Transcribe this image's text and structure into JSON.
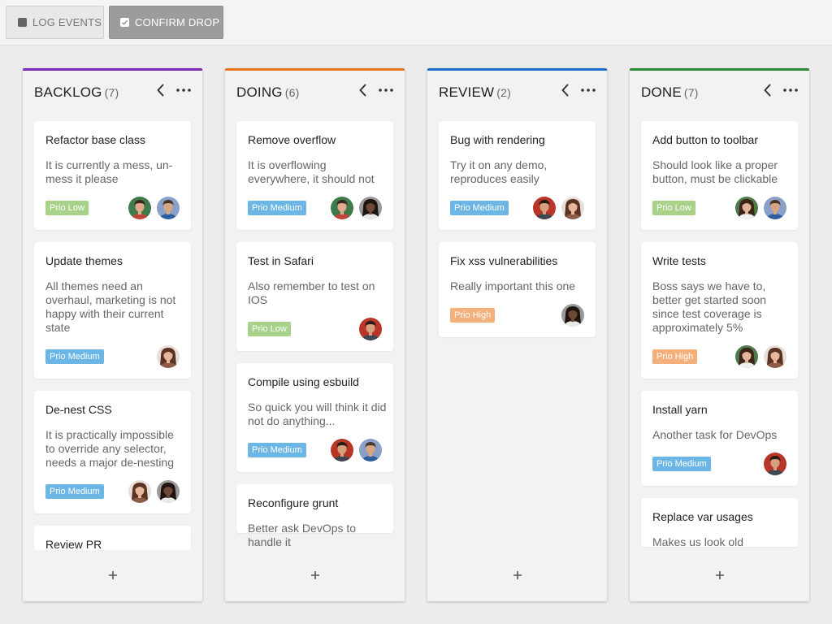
{
  "toolbar": {
    "log_events_label": "LOG EVENTS",
    "confirm_drop_label": "CONFIRM DROP"
  },
  "colors": {
    "backlog": "#7b2ab0",
    "doing": "#e8771e",
    "review": "#1e6fc9",
    "done": "#2e8b34",
    "prio_low": "#a8d18a",
    "prio_medium": "#6cb6e6",
    "prio_high": "#f4b07c"
  },
  "columns": [
    {
      "title": "BACKLOG",
      "count": "(7)",
      "collapse_icon": "chevron-left-icon",
      "menu_icon": "more-horizontal-icon",
      "add_icon": "plus-icon",
      "cards": [
        {
          "title": "Refactor base class",
          "description": "It is currently a mess, un-mess it please",
          "tag": "Prio Low",
          "avatars": [
            {
              "name": "avatar-man-green"
            },
            {
              "name": "avatar-man-blue"
            }
          ]
        },
        {
          "title": "Update themes",
          "description": "All themes need an overhaul, marketing is not happy with their current state",
          "tag": "Prio Medium",
          "avatars": [
            {
              "name": "avatar-woman-brown"
            }
          ]
        },
        {
          "title": "De-nest CSS",
          "description": "It is practically impossible to override any selector, needs a major de-nesting",
          "tag": "Prio Medium",
          "avatars": [
            {
              "name": "avatar-woman-brown"
            },
            {
              "name": "avatar-woman-curly"
            }
          ]
        },
        {
          "title": "Review PR",
          "description": "",
          "tag": "",
          "avatars": []
        }
      ]
    },
    {
      "title": "DOING",
      "count": "(6)",
      "collapse_icon": "chevron-left-icon",
      "menu_icon": "more-horizontal-icon",
      "add_icon": "plus-icon",
      "cards": [
        {
          "title": "Remove overflow",
          "description": "It is overflowing everywhere, it should not",
          "tag": "Prio Medium",
          "avatars": [
            {
              "name": "avatar-man-green"
            },
            {
              "name": "avatar-woman-curly"
            }
          ]
        },
        {
          "title": "Test in Safari",
          "description": "Also remember to test on IOS",
          "tag": "Prio Low",
          "avatars": [
            {
              "name": "avatar-man-red"
            }
          ]
        },
        {
          "title": "Compile using esbuild",
          "description": "So quick you will think it did not do anything...",
          "tag": "Prio Medium",
          "avatars": [
            {
              "name": "avatar-man-red"
            },
            {
              "name": "avatar-man-blue"
            }
          ]
        },
        {
          "title": "Reconfigure grunt",
          "description": "Better ask DevOps to handle it",
          "tag": "",
          "avatars": []
        }
      ]
    },
    {
      "title": "REVIEW",
      "count": "(2)",
      "collapse_icon": "chevron-left-icon",
      "menu_icon": "more-horizontal-icon",
      "add_icon": "plus-icon",
      "cards": [
        {
          "title": "Bug with rendering",
          "description": "Try it on any demo, reproduces easily",
          "tag": "Prio Medium",
          "avatars": [
            {
              "name": "avatar-man-red"
            },
            {
              "name": "avatar-woman-brown"
            }
          ]
        },
        {
          "title": "Fix xss vulnerabilities",
          "description": "Really important this one",
          "tag": "Prio High",
          "avatars": [
            {
              "name": "avatar-woman-curly"
            }
          ]
        }
      ]
    },
    {
      "title": "DONE",
      "count": "(7)",
      "collapse_icon": "chevron-left-icon",
      "menu_icon": "more-horizontal-icon",
      "add_icon": "plus-icon",
      "cards": [
        {
          "title": "Add button to toolbar",
          "description": "Should look like a proper button, must be clickable",
          "tag": "Prio Low",
          "avatars": [
            {
              "name": "avatar-woman-green"
            },
            {
              "name": "avatar-man-blue"
            }
          ]
        },
        {
          "title": "Write tests",
          "description": "Boss says we have to, better get started soon since test coverage is approximately 5%",
          "tag": "Prio High",
          "avatars": [
            {
              "name": "avatar-woman-green"
            },
            {
              "name": "avatar-woman-brown"
            }
          ]
        },
        {
          "title": "Install yarn",
          "description": "Another task for DevOps",
          "tag": "Prio Medium",
          "avatars": [
            {
              "name": "avatar-man-red"
            }
          ]
        },
        {
          "title": "Replace var usages",
          "description": "Makes us look old",
          "tag": "",
          "avatars": []
        }
      ]
    }
  ]
}
